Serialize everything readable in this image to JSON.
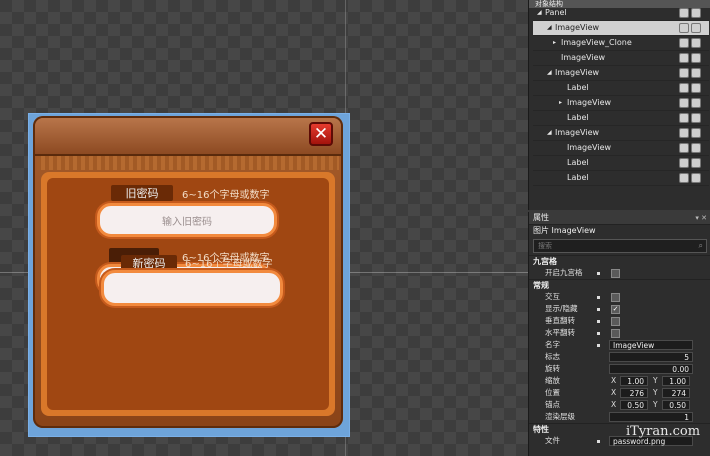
{
  "canvas": {
    "dialog": {
      "close_glyph": "✕",
      "old_pwd_label": "旧密码",
      "old_pwd_hint": "6~16个字母或数字",
      "old_pwd_placeholder": "输入旧密码",
      "new_pwd_label": "新密码",
      "new_pwd_hint": "6~16个字母或数字",
      "new_pwd_placeholder": ""
    }
  },
  "hierarchy": {
    "title": "对象结构",
    "items": [
      {
        "label": "Panel",
        "arrow": "◢"
      },
      {
        "label": "ImageView",
        "arrow": "◢",
        "selected": true
      },
      {
        "label": "ImageView_Clone",
        "arrow": "▸"
      },
      {
        "label": "ImageView",
        "arrow": ""
      },
      {
        "label": "ImageView",
        "arrow": "◢"
      },
      {
        "label": "Label",
        "arrow": ""
      },
      {
        "label": "ImageView",
        "arrow": "▸"
      },
      {
        "label": "Label",
        "arrow": ""
      },
      {
        "label": "ImageView",
        "arrow": "◢"
      },
      {
        "label": "ImageView",
        "arrow": ""
      },
      {
        "label": "Label",
        "arrow": ""
      },
      {
        "label": "Label",
        "arrow": ""
      }
    ]
  },
  "properties": {
    "title": "属性",
    "pin": "▾ ✕",
    "object_name": "图片 ImageView",
    "search_placeholder": "搜索",
    "section_nine": "九宫格",
    "enable_nine": "开启九宫格",
    "section_general": "常规",
    "interact": "交互",
    "show_hide": "显示/隐藏",
    "show_hide_checked": "✓",
    "flip_v": "垂直翻转",
    "flip_h": "水平翻转",
    "name_label": "名字",
    "name_value": "ImageView",
    "tag_label": "标志",
    "tag_value": "5",
    "rotation_label": "旋转",
    "rotation_value": "0.00",
    "scale_label": "缩放",
    "scale_x": "1.00",
    "scale_y": "1.00",
    "pos_label": "位置",
    "pos_x": "276",
    "pos_y": "274",
    "anchor_label": "锚点",
    "anchor_x": "0.50",
    "anchor_y": "0.50",
    "zorder_label": "渲染层级",
    "zorder_value": "1",
    "section_feature": "特性",
    "file_label": "文件",
    "file_value": "password.png",
    "axis_x": "X",
    "axis_y": "Y"
  },
  "watermark": "iTyran.com"
}
